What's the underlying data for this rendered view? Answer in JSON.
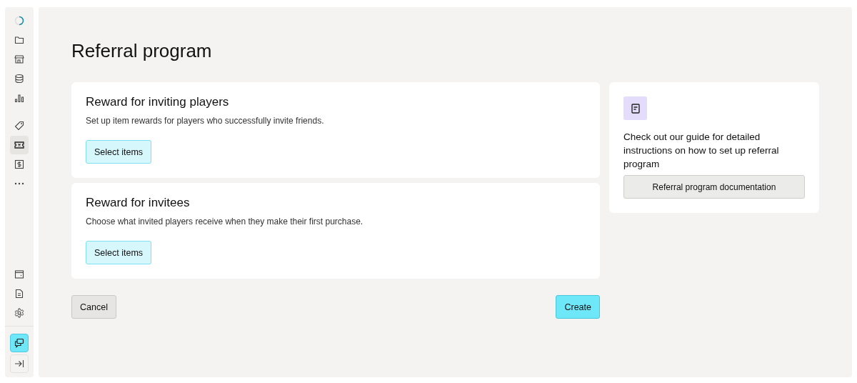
{
  "sidebar": {
    "top_items": [
      {
        "selected": false
      },
      {
        "selected": false
      },
      {
        "selected": false
      },
      {
        "selected": false
      },
      {
        "selected": false
      }
    ],
    "middle_items": [
      {
        "selected": false
      },
      {
        "selected": true
      },
      {
        "selected": false
      },
      {
        "selected": false
      }
    ],
    "bottom_items": [
      {
        "selected": false
      },
      {
        "selected": false
      },
      {
        "selected": false
      }
    ],
    "chat_button": {
      "active": true
    }
  },
  "page_title": "Referral program",
  "sections": [
    {
      "title": "Reward for inviting players",
      "description": "Set up item rewards for players who successfully invite friends.",
      "button": "Select items"
    },
    {
      "title": "Reward for invitees",
      "description": "Choose what invited players receive when they make their first purchase.",
      "button": "Select items"
    }
  ],
  "guide": {
    "text": "Check out our guide for detailed instructions on how to set up referral program",
    "button": "Referral program documentation"
  },
  "actions": {
    "cancel": "Cancel",
    "create": "Create"
  }
}
